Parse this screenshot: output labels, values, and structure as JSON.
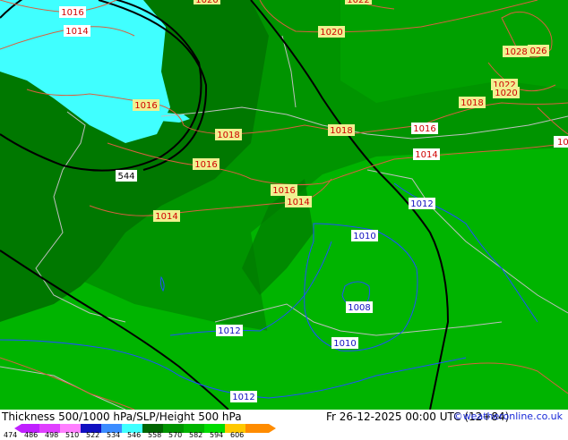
{
  "title": "Thickness 500/1000 hPa/SLP/Height 500 hPa",
  "datetime": "Fr 26-12-2025 00:00 UTC (12+84)",
  "copyright": "©weatheronline.co.uk",
  "colors": {
    "c474": "#c020ff",
    "c486": "#e040ff",
    "c498": "#ff80ff",
    "c510": "#1010c0",
    "c522": "#3c8cff",
    "c534": "#40ffff",
    "c546": "#006400",
    "c558": "#009400",
    "c570": "#00b400",
    "c582": "#00dc00",
    "c594": "#ffc800",
    "c606": "#ff8c00",
    "isobar": "#d86040",
    "isobar_low": "#2050ff",
    "height500": "#000000",
    "coast": "#bfbfbf"
  },
  "legend_ticks": [
    "474",
    "486",
    "498",
    "510",
    "522",
    "534",
    "546",
    "558",
    "570",
    "582",
    "594",
    "606"
  ],
  "isobar_labels": {
    "l1016a": "1016",
    "l1014a": "1014",
    "l1020top": "1020",
    "l1022top": "1022",
    "l1020": "1020",
    "l1028": "1028",
    "l026": "026",
    "l1022": "1022",
    "l1020b": "1020",
    "l1018a": "1018",
    "l1016b": "1016",
    "l1018b": "1018",
    "l1018c": "1018",
    "l1016c": "1016",
    "l101right": "101",
    "l1016d": "1016",
    "l1014b": "1014",
    "l1016e": "1016",
    "l1014c": "1014",
    "l1014d": "1014",
    "l1012a": "1012",
    "l1010a": "1010",
    "l1008": "1008",
    "l1012b": "1012",
    "l1010b": "1010",
    "l1012c": "1012"
  },
  "height_labels": {
    "h544": "544"
  }
}
